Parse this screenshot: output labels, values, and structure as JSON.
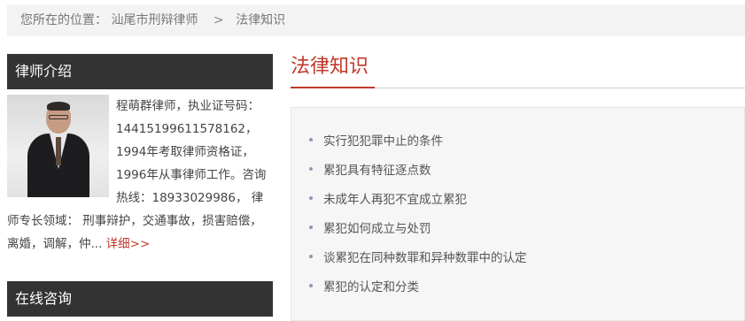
{
  "breadcrumb": {
    "prefix": "您所在的位置：",
    "home": "汕尾市刑辩律师",
    "separator": ">",
    "current": "法律知识"
  },
  "sidebar": {
    "intro_title": "律师介绍",
    "intro_text": "程萌群律师，执业证号码：14415199611578162，1994年考取律师资格证，1996年从事律师工作。咨询热线：18933029986， 律师专长领域： 刑事辩护，交通事故，损害赔偿，离婚，调解，仲...",
    "more_label": "详细>>",
    "consult_title": "在线咨询"
  },
  "main": {
    "section_title": "法律知识",
    "articles": [
      "实行犯犯罪中止的条件",
      "累犯具有特征逐点数",
      "未成年人再犯不宜成立累犯",
      "累犯如何成立与处罚",
      "谈累犯在同种数罪和异种数罪中的认定",
      "累犯的认定和分类"
    ]
  },
  "colors": {
    "accent": "#c0392b",
    "sidebar_header_bg": "#333333",
    "breadcrumb_bg": "#f3f3f3"
  }
}
